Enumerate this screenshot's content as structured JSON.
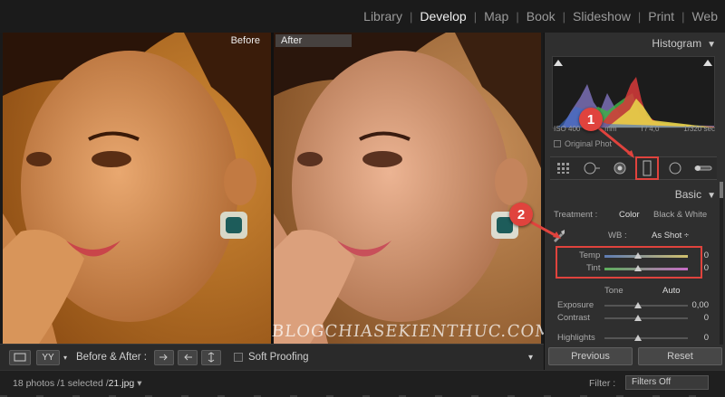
{
  "modules": [
    "Library",
    "Develop",
    "Map",
    "Book",
    "Slideshow",
    "Print",
    "Web"
  ],
  "active_module": "Develop",
  "panes": {
    "before_label": "Before",
    "after_label": "After"
  },
  "watermark": "BLOGCHIASEKIENTHUC.COM",
  "toolbar": {
    "view_mode": "YY",
    "before_after_label": "Before & After :",
    "soft_proofing_label": "Soft Proofing"
  },
  "filmstrip": {
    "status": "18 photos /1 selected /",
    "filename": "21.jpg",
    "filter_label": "Filter :",
    "filter_value": "Filters Off"
  },
  "panel": {
    "histogram_title": "Histogram",
    "histogram_info": {
      "iso": "ISO 400",
      "focal": "mm",
      "aperture": "f / 4,0",
      "shutter": "1/320 sec"
    },
    "original_photo_label": "Original Phot",
    "basic_title": "Basic",
    "treatment_label": "Treatment :",
    "treatment_color": "Color",
    "treatment_bw": "Black & White",
    "wb_label": "WB :",
    "wb_value": "As Shot",
    "temp_label": "Temp",
    "temp_value": "0",
    "tint_label": "Tint",
    "tint_value": "0",
    "tone_label": "Tone",
    "auto_label": "Auto",
    "exposure_label": "Exposure",
    "exposure_value": "0,00",
    "contrast_label": "Contrast",
    "contrast_value": "0",
    "highlights_label": "Highlights",
    "highlights_value": "0",
    "previous_label": "Previous",
    "reset_label": "Reset"
  },
  "callouts": [
    "1",
    "2"
  ],
  "colors": {
    "accent_red": "#e0433d",
    "panel_bg": "#2f2f2f",
    "app_bg": "#1a1a1a"
  },
  "icons": [
    "grid-icon",
    "crop-icon",
    "spot-removal-icon",
    "red-eye-icon",
    "graduated-filter-icon",
    "radial-filter-icon",
    "adjustment-brush-icon",
    "wb-eyedropper-icon"
  ]
}
